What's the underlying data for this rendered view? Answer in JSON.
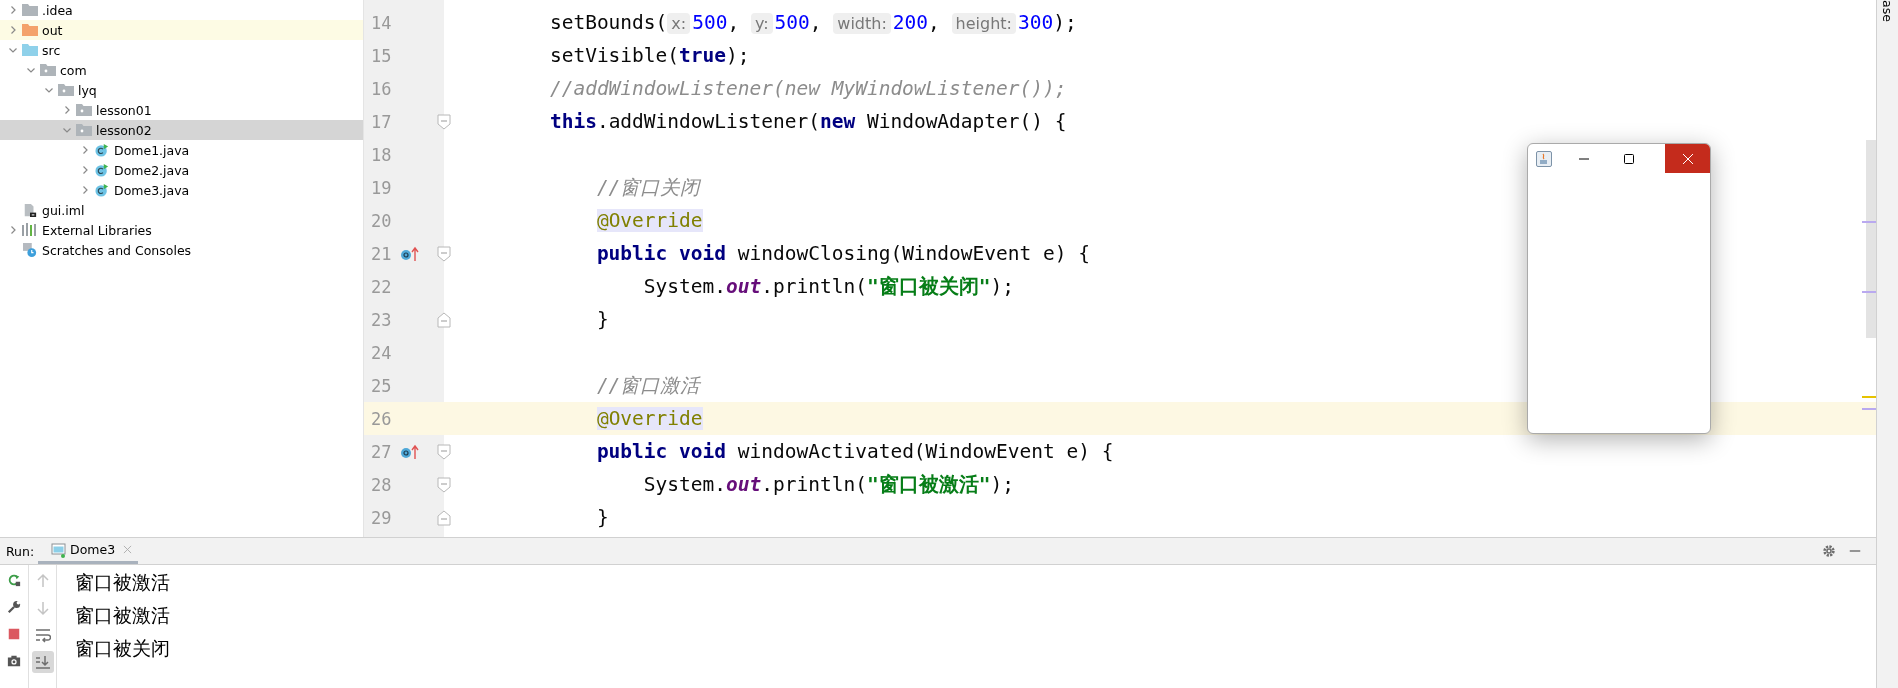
{
  "project_tree": [
    {
      "label": ".idea",
      "kind": "folder",
      "expanded": false,
      "selected": false,
      "highlighted": false
    },
    {
      "label": "out",
      "kind": "excluded_folder",
      "expanded": false,
      "selected": false,
      "highlighted": true
    },
    {
      "label": "src",
      "kind": "source_folder",
      "expanded": true,
      "selected": false,
      "highlighted": false,
      "children": [
        {
          "label": "com",
          "kind": "package",
          "expanded": true,
          "selected": false,
          "highlighted": false,
          "children": [
            {
              "label": "lyq",
              "kind": "package",
              "expanded": true,
              "selected": false,
              "highlighted": false,
              "children": [
                {
                  "label": "lesson01",
                  "kind": "package",
                  "expanded": false,
                  "selected": false,
                  "highlighted": false
                },
                {
                  "label": "lesson02",
                  "kind": "package",
                  "expanded": true,
                  "selected": true,
                  "highlighted": false,
                  "children": [
                    {
                      "label": "Dome1.java",
                      "kind": "class",
                      "expanded": false,
                      "selected": false,
                      "highlighted": false
                    },
                    {
                      "label": "Dome2.java",
                      "kind": "class",
                      "expanded": false,
                      "selected": false,
                      "highlighted": false
                    },
                    {
                      "label": "Dome3.java",
                      "kind": "class",
                      "expanded": false,
                      "selected": false,
                      "highlighted": false
                    }
                  ]
                }
              ]
            }
          ]
        }
      ]
    },
    {
      "label": "gui.iml",
      "kind": "module_file",
      "selected": false,
      "highlighted": false
    },
    {
      "label": "External Libraries",
      "kind": "libraries",
      "expanded": false,
      "selected": false,
      "highlighted": false
    },
    {
      "label": "Scratches and Consoles",
      "kind": "scratches",
      "selected": false,
      "highlighted": false
    }
  ],
  "editor": {
    "lines": [
      {
        "number": "14",
        "current": false,
        "override_marker": false,
        "tokens": [
          {
            "kind": "plain",
            "text": "        setBounds("
          },
          {
            "kind": "hint",
            "text": "x:"
          },
          {
            "kind": "number",
            "text": "500"
          },
          {
            "kind": "plain",
            "text": ", "
          },
          {
            "kind": "hint",
            "text": "y:"
          },
          {
            "kind": "number",
            "text": "500"
          },
          {
            "kind": "plain",
            "text": ", "
          },
          {
            "kind": "hint",
            "text": "width:"
          },
          {
            "kind": "number",
            "text": "200"
          },
          {
            "kind": "plain",
            "text": ", "
          },
          {
            "kind": "hint",
            "text": "height:"
          },
          {
            "kind": "number",
            "text": "300"
          },
          {
            "kind": "plain",
            "text": ");"
          }
        ]
      },
      {
        "number": "15",
        "current": false,
        "override_marker": false,
        "tokens": [
          {
            "kind": "plain",
            "text": "        setVisible("
          },
          {
            "kind": "keyword",
            "text": "true"
          },
          {
            "kind": "plain",
            "text": ");"
          }
        ]
      },
      {
        "number": "16",
        "current": false,
        "override_marker": false,
        "tokens": [
          {
            "kind": "comment",
            "text": "        //addWindowListener(new MyWindowListener());"
          }
        ]
      },
      {
        "number": "17",
        "current": false,
        "override_marker": false,
        "fold_start": true,
        "fold_end": false,
        "tokens": [
          {
            "kind": "keyword",
            "text": "        this"
          },
          {
            "kind": "plain",
            "text": ".addWindowListener("
          },
          {
            "kind": "keyword",
            "text": "new"
          },
          {
            "kind": "plain",
            "text": " WindowAdapter() {"
          }
        ]
      },
      {
        "number": "18",
        "current": false,
        "override_marker": false
      },
      {
        "number": "19",
        "current": false,
        "override_marker": false,
        "tokens": [
          {
            "kind": "comment",
            "text": "            //窗口关闭"
          }
        ]
      },
      {
        "number": "20",
        "current": false,
        "override_marker": false,
        "tokens": [
          {
            "kind": "annotation",
            "text": "            @Override"
          }
        ]
      },
      {
        "number": "21",
        "current": false,
        "override_marker": true,
        "fold_start": true,
        "fold_end": false,
        "tokens": [
          {
            "kind": "keyword",
            "text": "            public void"
          },
          {
            "kind": "plain",
            "text": " windowClosing(WindowEvent e) {"
          }
        ]
      },
      {
        "number": "22",
        "current": false,
        "override_marker": false,
        "tokens": [
          {
            "kind": "plain",
            "text": "                System."
          },
          {
            "kind": "field",
            "text": "out"
          },
          {
            "kind": "plain",
            "text": ".println("
          },
          {
            "kind": "string",
            "text": "\"窗口被关闭\""
          },
          {
            "kind": "plain",
            "text": ");"
          }
        ]
      },
      {
        "number": "23",
        "current": false,
        "override_marker": false,
        "fold_start": false,
        "fold_end": true,
        "tokens": [
          {
            "kind": "plain",
            "text": "            }"
          }
        ]
      },
      {
        "number": "24",
        "current": false,
        "override_marker": false
      },
      {
        "number": "25",
        "current": false,
        "override_marker": false,
        "tokens": [
          {
            "kind": "comment",
            "text": "            //窗口激活"
          }
        ]
      },
      {
        "number": "26",
        "current": true,
        "override_marker": false,
        "tokens": [
          {
            "kind": "annotation",
            "text": "            @Override"
          }
        ]
      },
      {
        "number": "27",
        "current": false,
        "override_marker": true,
        "fold_start": true,
        "fold_end": false,
        "tokens": [
          {
            "kind": "keyword",
            "text": "            public void"
          },
          {
            "kind": "plain",
            "text": " windowActivated(WindowEvent e) {"
          }
        ]
      },
      {
        "number": "28",
        "current": false,
        "override_marker": false,
        "fold_start": true,
        "fold_end": false,
        "tokens": [
          {
            "kind": "plain",
            "text": "                System."
          },
          {
            "kind": "field",
            "text": "out"
          },
          {
            "kind": "plain",
            "text": ".println("
          },
          {
            "kind": "string",
            "text": "\"窗口被激活\""
          },
          {
            "kind": "plain",
            "text": ");"
          }
        ]
      },
      {
        "number": "29",
        "current": false,
        "override_marker": false,
        "fold_start": false,
        "fold_end": true,
        "tokens": [
          {
            "kind": "plain",
            "text": "            }"
          }
        ]
      }
    ]
  },
  "right_stripe": {
    "label": "ase"
  },
  "run_panel": {
    "label": "Run:",
    "tabs": [
      {
        "label": "Dome3",
        "selected": true
      }
    ],
    "tools_left": [
      {
        "kind": "rerun"
      },
      {
        "kind": "wrench"
      },
      {
        "kind": "stop"
      },
      {
        "kind": "camera"
      }
    ],
    "tools_right": [
      {
        "kind": "up",
        "disabled": true,
        "on": false
      },
      {
        "kind": "down",
        "disabled": true,
        "on": false
      },
      {
        "kind": "wrap",
        "disabled": false,
        "on": false
      },
      {
        "kind": "scroll_end",
        "disabled": false,
        "on": true
      }
    ],
    "output": [
      "窗口被激活",
      "窗口被激活",
      "窗口被关闭"
    ]
  }
}
